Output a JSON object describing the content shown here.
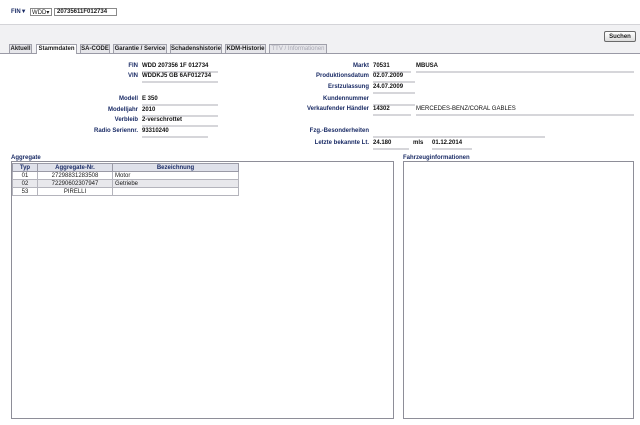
{
  "search": {
    "fin_label": "FIN",
    "fin_dropdown_arrow": "▼",
    "type_selected": "WDD",
    "fin_value": "20735611F012734",
    "search_button": "Suchen"
  },
  "tabs": [
    {
      "label": "Aktuell"
    },
    {
      "label": "Stammdaten"
    },
    {
      "label": "SA-CODE"
    },
    {
      "label": "Garantie / Service"
    },
    {
      "label": "Schadenshistorie"
    },
    {
      "label": "KDM-Historie"
    },
    {
      "label": "TTV / Informationen"
    }
  ],
  "stamm": {
    "left": [
      {
        "label": "FIN",
        "value": "WDD 207356 1F 012734"
      },
      {
        "label": "VIN",
        "value": "WDDKJ5 GB 6AF012734"
      },
      {
        "label": "Modell",
        "value": "E 350"
      },
      {
        "label": "Modelljahr",
        "value": "2010"
      },
      {
        "label": "Verbleib",
        "value": "2-verschrottet"
      },
      {
        "label": "Radio Seriennr.",
        "value": "93310240"
      }
    ],
    "right": [
      {
        "label": "Markt",
        "value": "70531",
        "extra": "MBUSA"
      },
      {
        "label": "Produktionsdatum",
        "value": "02.07.2009"
      },
      {
        "label": "Erstzulassung",
        "value": "24.07.2009"
      },
      {
        "label": "Kundennummer",
        "value": ""
      },
      {
        "label": "Verkaufender Händler",
        "value": "14302",
        "extra": "MERCEDES-BENZ/CORAL GABLES"
      },
      {
        "label": "Fzg.-Besonderheiten",
        "value": ""
      },
      {
        "label": "Letzte bekannte Lt.",
        "value": "24.180",
        "unit": "mls",
        "date": "01.12.2014"
      }
    ]
  },
  "aggregate": {
    "title": "Aggregate",
    "columns": [
      "Typ",
      "Aggregate-Nr.",
      "Bezeichnung"
    ],
    "rows": [
      [
        "01",
        "27298831283508",
        "Motor"
      ],
      [
        "02",
        "72290602307947",
        "Getriebe"
      ],
      [
        "53",
        "PIRELLI",
        ""
      ]
    ]
  },
  "fahrzeug": {
    "title": "Fahrzeuginformationen"
  }
}
